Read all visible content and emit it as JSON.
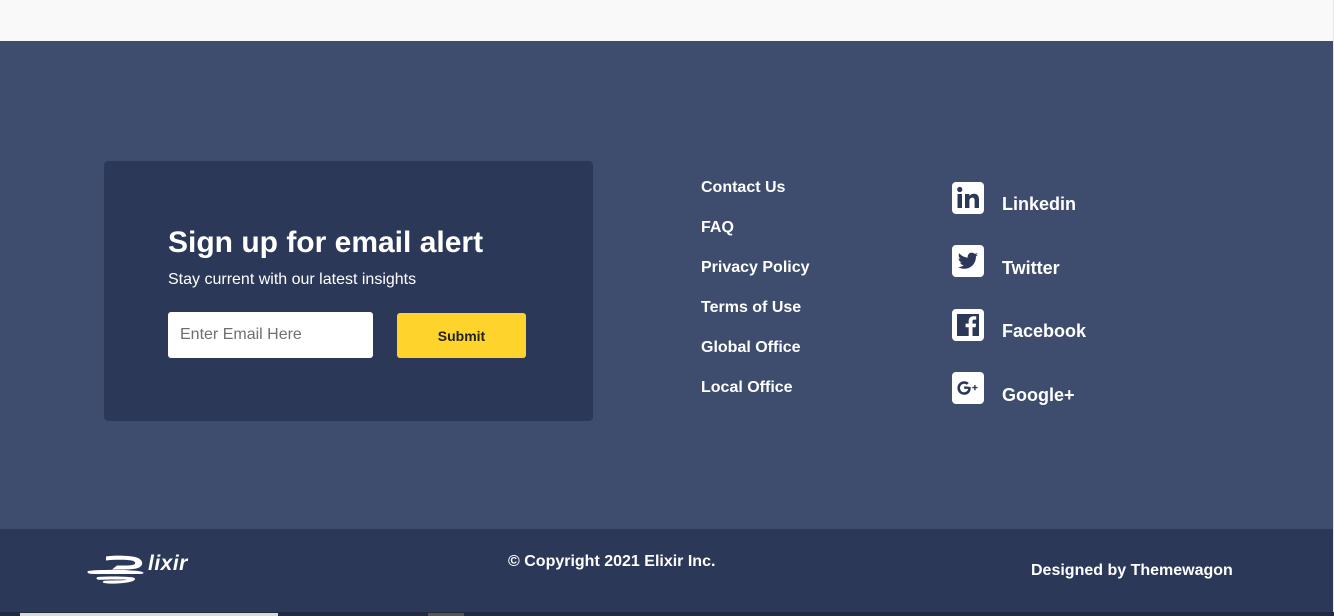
{
  "signup": {
    "title": "Sign up for email alert",
    "subtitle": "Stay current with our latest insights",
    "email_placeholder": "Enter Email Here",
    "submit_label": "Submit"
  },
  "links": [
    {
      "label": "Contact Us"
    },
    {
      "label": "FAQ"
    },
    {
      "label": "Privacy Policy"
    },
    {
      "label": "Terms of Use"
    },
    {
      "label": "Global Office"
    },
    {
      "label": "Local Office"
    }
  ],
  "social": [
    {
      "label": "Linkedin",
      "icon": "linkedin-icon"
    },
    {
      "label": "Twitter",
      "icon": "twitter-icon"
    },
    {
      "label": "Facebook",
      "icon": "facebook-icon"
    },
    {
      "label": "Google+",
      "icon": "google-plus-icon"
    }
  ],
  "bottom": {
    "logo_text": "lixir",
    "copyright": "© Copyright 2021 Elixir Inc.",
    "designed_prefix": "Designed by",
    "designed_link": "Themewagon"
  },
  "colors": {
    "footer_bg": "#3e4c6e",
    "card_bg": "#2c3858",
    "accent": "#fed32c",
    "text": "#ffffff"
  }
}
